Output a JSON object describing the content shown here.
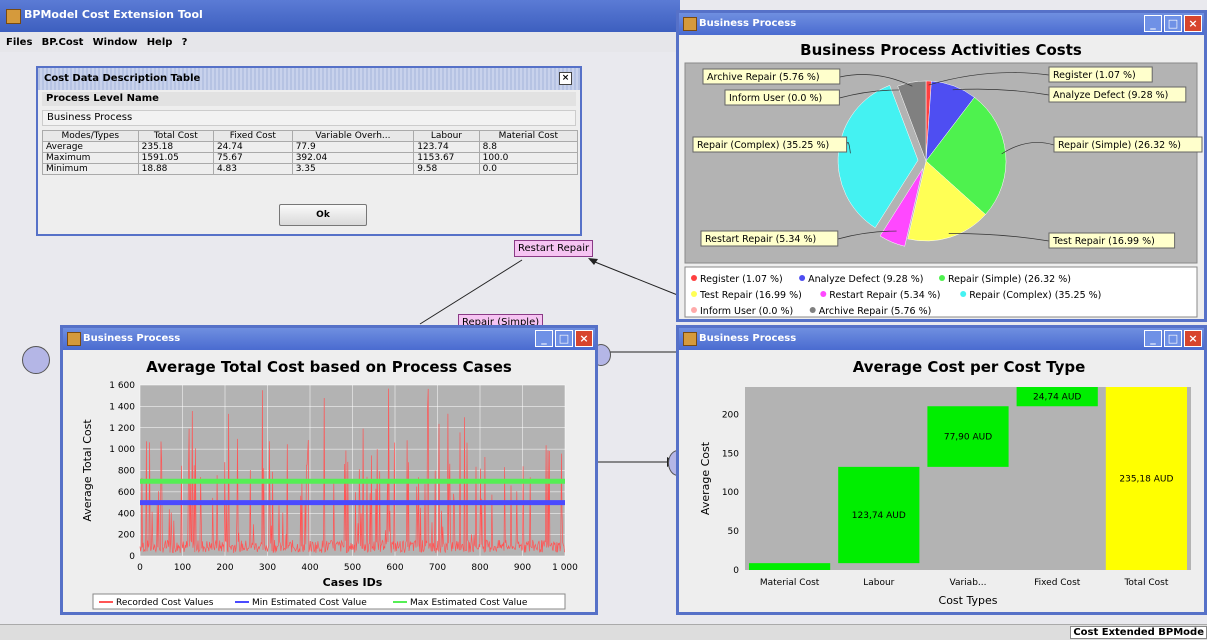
{
  "app": {
    "title": "BPModel Cost Extension Tool",
    "menu": [
      "Files",
      "BP.Cost",
      "Window",
      "Help",
      "?"
    ],
    "status": "Cost Extended BPMode"
  },
  "cost_dialog": {
    "title": "Cost Data Description Table",
    "section_label": "Process Level Name",
    "process_name": "Business Process",
    "columns": [
      "Modes/Types",
      "Total Cost",
      "Fixed Cost",
      "Variable Overh...",
      "Labour",
      "Material Cost"
    ],
    "rows": [
      [
        "Average",
        "235.18",
        "24.74",
        "77.9",
        "123.74",
        "8.8"
      ],
      [
        "Maximum",
        "1591.05",
        "75.67",
        "392.04",
        "1153.67",
        "100.0"
      ],
      [
        "Minimum",
        "18.88",
        "4.83",
        "3.35",
        "9.58",
        "0.0"
      ]
    ],
    "ok_label": "Ok"
  },
  "diagram": {
    "restart_repair": "Restart Repair",
    "repair_simple": "Repair (Simple)"
  },
  "windows": {
    "pie_title": "Business Process",
    "line_title": "Business Process",
    "bar_title": "Business Process"
  },
  "chart_data": [
    {
      "type": "pie",
      "title": "Business Process Activities Costs",
      "slices": [
        {
          "label": "Register (1.07 %)",
          "legend": "Register (1.07 %)",
          "value": 1.07,
          "color": "#ff4040"
        },
        {
          "label": "Analyze Defect (9.28 %)",
          "legend": "Analyze Defect (9.28 %)",
          "value": 9.28,
          "color": "#4e4ef2"
        },
        {
          "label": "Repair (Simple) (26.32 %)",
          "legend": "Repair (Simple) (26.32 %)",
          "value": 26.32,
          "color": "#4ef24e"
        },
        {
          "label": "Test Repair (16.99 %)",
          "legend": "Test Repair (16.99 %)",
          "value": 16.99,
          "color": "#ffff55"
        },
        {
          "label": "Restart Repair (5.34 %)",
          "legend": "Restart Repair (5.34 %)",
          "value": 5.34,
          "color": "#ff48ff"
        },
        {
          "label": "Repair (Complex) (35.25 %)",
          "legend": "Repair (Complex) (35.25 %)",
          "value": 35.25,
          "color": "#44f2f2"
        },
        {
          "label": "Inform User (0.0 %)",
          "legend": "Inform User (0.0 %)",
          "value": 0.0,
          "color": "#ffaaaa"
        },
        {
          "label": "Archive Repair (5.76 %)",
          "legend": "Archive Repair (5.76 %)",
          "value": 5.76,
          "color": "#808080"
        }
      ]
    },
    {
      "type": "line",
      "title": "Average Total Cost based on Process Cases",
      "xlabel": "Cases IDs",
      "ylabel": "Average Total Cost",
      "xlim": [
        0,
        1000
      ],
      "ylim": [
        0,
        1600
      ],
      "xticks": [
        "0",
        "100",
        "200",
        "300",
        "400",
        "500",
        "600",
        "700",
        "800",
        "900",
        "1 000"
      ],
      "yticks": [
        "0",
        "200",
        "400",
        "600",
        "800",
        "1 000",
        "1 200",
        "1 400",
        "1 600"
      ],
      "series": [
        {
          "name": "Recorded Cost Values",
          "color": "#ff5555",
          "style": "dense noisy spikes between roughly 20 and 1600"
        },
        {
          "name": "Min Estimated Cost Value",
          "color": "#4a4aff",
          "x": [
            0,
            1000
          ],
          "y": [
            500,
            500
          ]
        },
        {
          "name": "Max Estimated Cost Value",
          "color": "#55ee55",
          "x": [
            0,
            1000
          ],
          "y": [
            700,
            700
          ]
        }
      ],
      "legend_position": "bottom"
    },
    {
      "type": "bar",
      "title": "Average Cost per Cost Type",
      "xlabel": "Cost Types",
      "ylabel": "Average Cost",
      "ylim": [
        0,
        235.18
      ],
      "yticks": [
        "0",
        "50",
        "100",
        "150",
        "200"
      ],
      "categories": [
        "Material Cost",
        "Labour",
        "Variab...",
        "Fixed Cost",
        "Total Cost"
      ],
      "bars": [
        {
          "start": 0,
          "end": 8.8,
          "label": "",
          "color": "#00ee00"
        },
        {
          "start": 8.8,
          "end": 132.54,
          "label": "123,74 AUD",
          "color": "#00ee00"
        },
        {
          "start": 132.54,
          "end": 210.44,
          "label": "77,90 AUD",
          "color": "#00ee00"
        },
        {
          "start": 210.44,
          "end": 235.18,
          "label": "24,74 AUD",
          "color": "#00ee00"
        },
        {
          "start": 0,
          "end": 235.18,
          "label": "235,18 AUD",
          "color": "#ffff00"
        }
      ]
    }
  ]
}
